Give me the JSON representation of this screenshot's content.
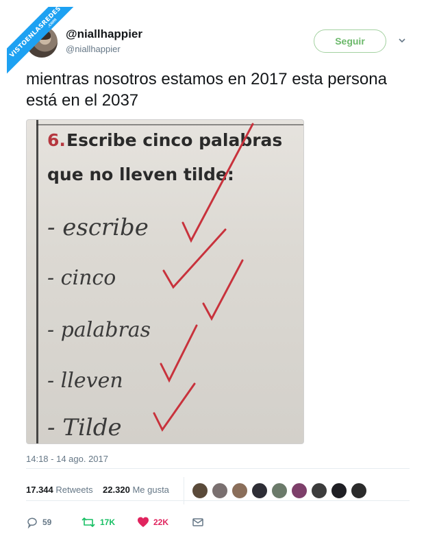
{
  "watermark": {
    "text": "VISTOENLASREDES",
    "sub": ".com"
  },
  "header": {
    "display_name": "@niallhappier",
    "handle": "@niallhappier",
    "follow_label": "Seguir"
  },
  "tweet": {
    "text": "mientras nosotros estamos en 2017 esta persona está en el 2037",
    "timestamp": "14:18 - 14 ago. 2017"
  },
  "photo": {
    "question_number": "6.",
    "question_line1": "Escribe cinco palabras",
    "question_line2": "que no lleven tilde:",
    "answers": [
      "- escribe",
      "- cinco",
      "- palabras",
      "- lleven",
      "- Tilde"
    ]
  },
  "stats": {
    "retweets_count": "17.344",
    "retweets_label": "Retweets",
    "likes_count": "22.320",
    "likes_label": "Me gusta"
  },
  "actions": {
    "reply_count": "59",
    "retweet_count": "17K",
    "like_count": "22K"
  },
  "colors": {
    "accent": "#1da1f2",
    "follow_green": "#6bb86a",
    "retweet_green": "#17bf63",
    "like_red": "#e0245e",
    "check_red": "#c8323c"
  },
  "icons": {
    "chevron": "chevron-down-icon",
    "reply": "reply-icon",
    "retweet": "retweet-icon",
    "like": "heart-icon",
    "dm": "envelope-icon"
  }
}
